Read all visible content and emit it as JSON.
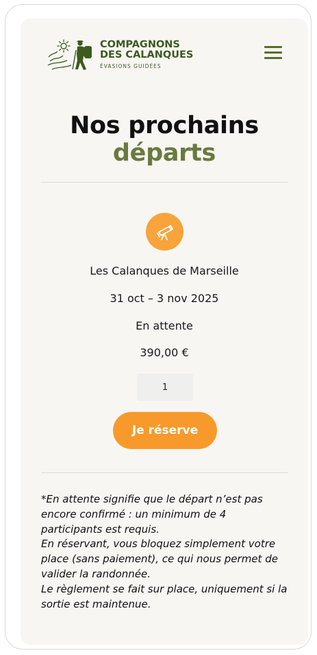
{
  "brand": {
    "name_line1": "COMPAGNONS",
    "name_line2": "DES CALANQUES",
    "tagline": "ÉVASIONS GUIDÉES",
    "color": "#3d5a1f"
  },
  "header": {
    "menu_icon": "hamburger-menu-icon"
  },
  "page": {
    "title_line1": "Nos prochains",
    "title_line2": "départs",
    "title_accent_color": "#6a7a3e"
  },
  "departure": {
    "icon": "telescope-icon",
    "destination": "Les Calanques de Marseille",
    "dates": "31 oct – 3 nov 2025",
    "status": "En attente",
    "price": "390,00 €",
    "quantity": "1",
    "reserve_label": "Je réserve",
    "accent_color": "#f79a2b"
  },
  "note": {
    "lines": [
      "*En attente signifie que le départ n’est pas encore confirmé : un minimum de 4 participants est requis.",
      "En réservant, vous bloquez simplement votre place (sans paiement), ce qui nous permet de valider la randonnée.",
      "Le règlement se fait sur place, uniquement si la sortie est maintenue."
    ]
  }
}
